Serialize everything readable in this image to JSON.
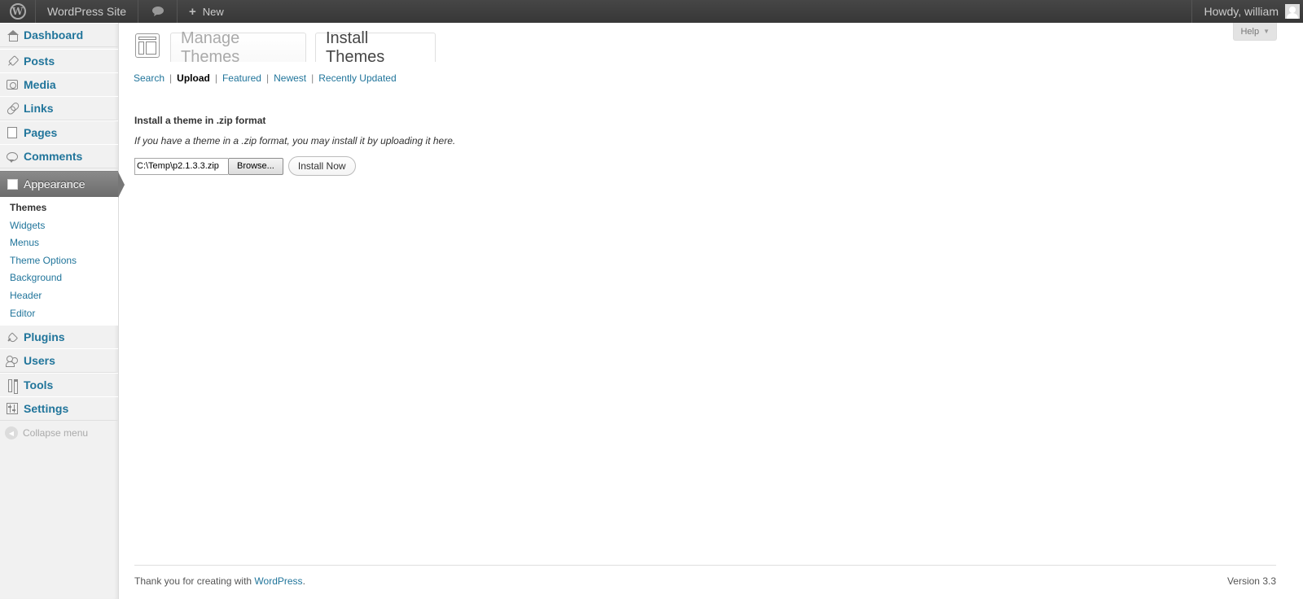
{
  "adminbar": {
    "site_name": "WordPress Site",
    "new_label": "New",
    "howdy": "Howdy, william"
  },
  "menu": {
    "items": [
      {
        "label": "Dashboard",
        "icon": "dashboard-icon"
      },
      {
        "label": "Posts",
        "icon": "pin-icon"
      },
      {
        "label": "Media",
        "icon": "media-icon"
      },
      {
        "label": "Links",
        "icon": "link-icon"
      },
      {
        "label": "Pages",
        "icon": "pages-icon"
      },
      {
        "label": "Comments",
        "icon": "comments-icon"
      },
      {
        "label": "Appearance",
        "icon": "appearance-icon",
        "current": true
      },
      {
        "label": "Plugins",
        "icon": "plugins-icon"
      },
      {
        "label": "Users",
        "icon": "users-icon"
      },
      {
        "label": "Tools",
        "icon": "tools-icon"
      },
      {
        "label": "Settings",
        "icon": "settings-icon"
      }
    ],
    "submenu": [
      {
        "label": "Themes",
        "current": true
      },
      {
        "label": "Widgets"
      },
      {
        "label": "Menus"
      },
      {
        "label": "Theme Options"
      },
      {
        "label": "Background"
      },
      {
        "label": "Header"
      },
      {
        "label": "Editor"
      }
    ],
    "collapse_label": "Collapse menu"
  },
  "help": {
    "label": "Help"
  },
  "tabs": {
    "manage": "Manage Themes",
    "install": "Install Themes"
  },
  "subsub": {
    "search": "Search",
    "upload": "Upload",
    "featured": "Featured",
    "newest": "Newest",
    "recent": "Recently Updated",
    "separator": "|"
  },
  "upload": {
    "heading": "Install a theme in .zip format",
    "description": "If you have a theme in a .zip format, you may install it by uploading it here.",
    "file_value": "C:\\Temp\\p2.1.3.3.zip",
    "browse_label": "Browse...",
    "install_label": "Install Now"
  },
  "footer": {
    "thanks": "Thank you for creating with",
    "wordpress": "WordPress",
    "period": ".",
    "version": "Version 3.3"
  },
  "colors": {
    "link": "#21759b",
    "adminbar": "#464646",
    "menu_current": "#777777"
  }
}
